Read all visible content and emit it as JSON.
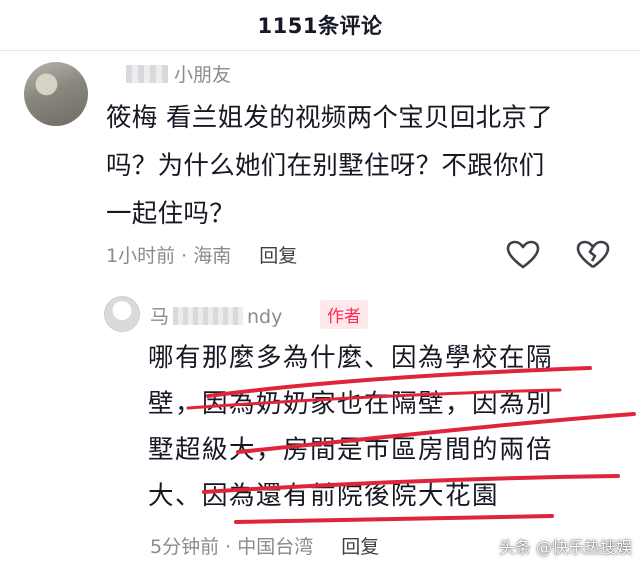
{
  "header": {
    "title": "1151条评论"
  },
  "comments": [
    {
      "author": "小朋友",
      "text_lines": [
        "筱梅 看兰姐发的视频两个宝贝回北京了",
        "吗？为什么她们在别墅住呀？不跟你们",
        "一起住吗？"
      ],
      "time": "1小时前",
      "location": "海南",
      "reply_label": "回复"
    },
    {
      "author_prefix": "马",
      "author_suffix": "ndy",
      "badge": "作者",
      "text_lines": [
        "哪有那麼多為什麼、因為學校在隔",
        "壁，因為奶奶家也在隔壁，因為別",
        "墅超級大，房間是市區房間的兩倍",
        "大、因為還有前院後院大花園"
      ],
      "time": "5分钟前",
      "location": "中国台湾",
      "reply_label": "回复"
    }
  ],
  "watermark": "头条 @快乐热搜娱",
  "colors": {
    "accent": "#fe2c55",
    "muted": "#8a8b91",
    "annotation": "#e0243a"
  }
}
